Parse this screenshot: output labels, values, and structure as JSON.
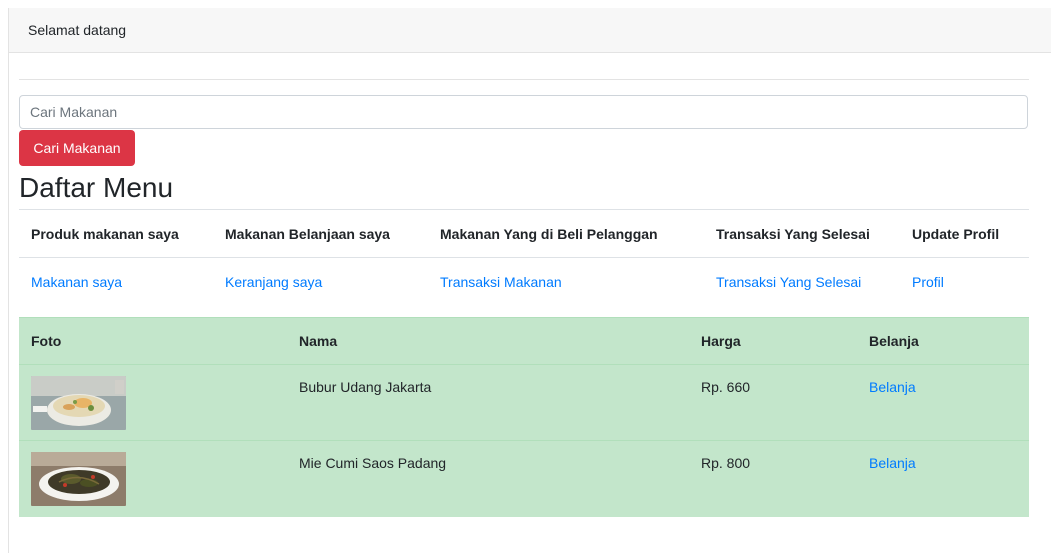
{
  "header": {
    "welcome": "Selamat datang"
  },
  "search": {
    "placeholder": "Cari Makanan",
    "button_label": "Cari Makanan"
  },
  "page_title": "Daftar Menu",
  "nav": {
    "headers": [
      "Produk makanan saya",
      "Makanan Belanjaan saya",
      "Makanan Yang di Beli Pelanggan",
      "Transaksi Yang Selesai",
      "Update Profil"
    ],
    "links": [
      "Makanan saya",
      "Keranjang saya",
      "Transaksi Makanan",
      "Transaksi Yang Selesai",
      "Profil"
    ]
  },
  "menu": {
    "columns": [
      "Foto",
      "Nama",
      "Harga",
      "Belanja"
    ],
    "rows": [
      {
        "photo": "bubur-photo",
        "nama": "Bubur Udang Jakarta",
        "harga": "Rp. 660",
        "action": "Belanja"
      },
      {
        "photo": "mie-photo",
        "nama": "Mie Cumi Saos Padang",
        "harga": "Rp. 800",
        "action": "Belanja"
      }
    ]
  },
  "colors": {
    "danger": "#dc3545",
    "link": "#007bff",
    "table_success": "#c3e6cb"
  }
}
